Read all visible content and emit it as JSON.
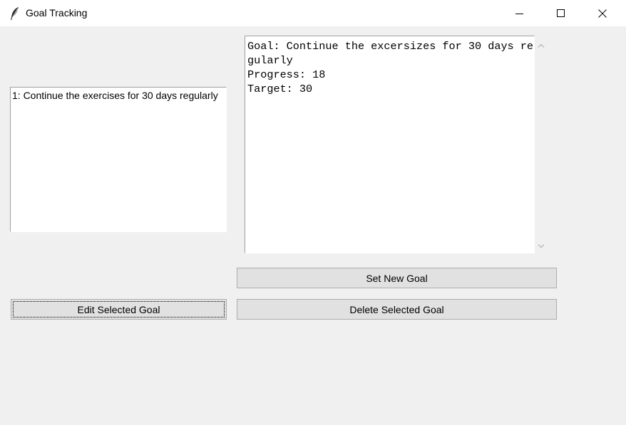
{
  "window": {
    "title": "Goal Tracking",
    "icon": "feather-icon",
    "controls": [
      "minimize-icon",
      "maximize-icon",
      "close-icon"
    ]
  },
  "goal_list": {
    "items": [
      "1: Continue the exercises for 30 days regularly"
    ]
  },
  "details": {
    "text": "Goal: Continue the excersizes for 30 days regularly\nProgress: 18\nTarget: 30"
  },
  "buttons": {
    "set_new_goal": "Set New Goal",
    "edit_selected_goal": "Edit Selected Goal",
    "delete_selected_goal": "Delete Selected Goal"
  },
  "colors": {
    "window_bg": "#f0f0f0",
    "titlebar_bg": "#ffffff",
    "button_bg": "#e1e1e1",
    "button_border": "#adadad"
  }
}
